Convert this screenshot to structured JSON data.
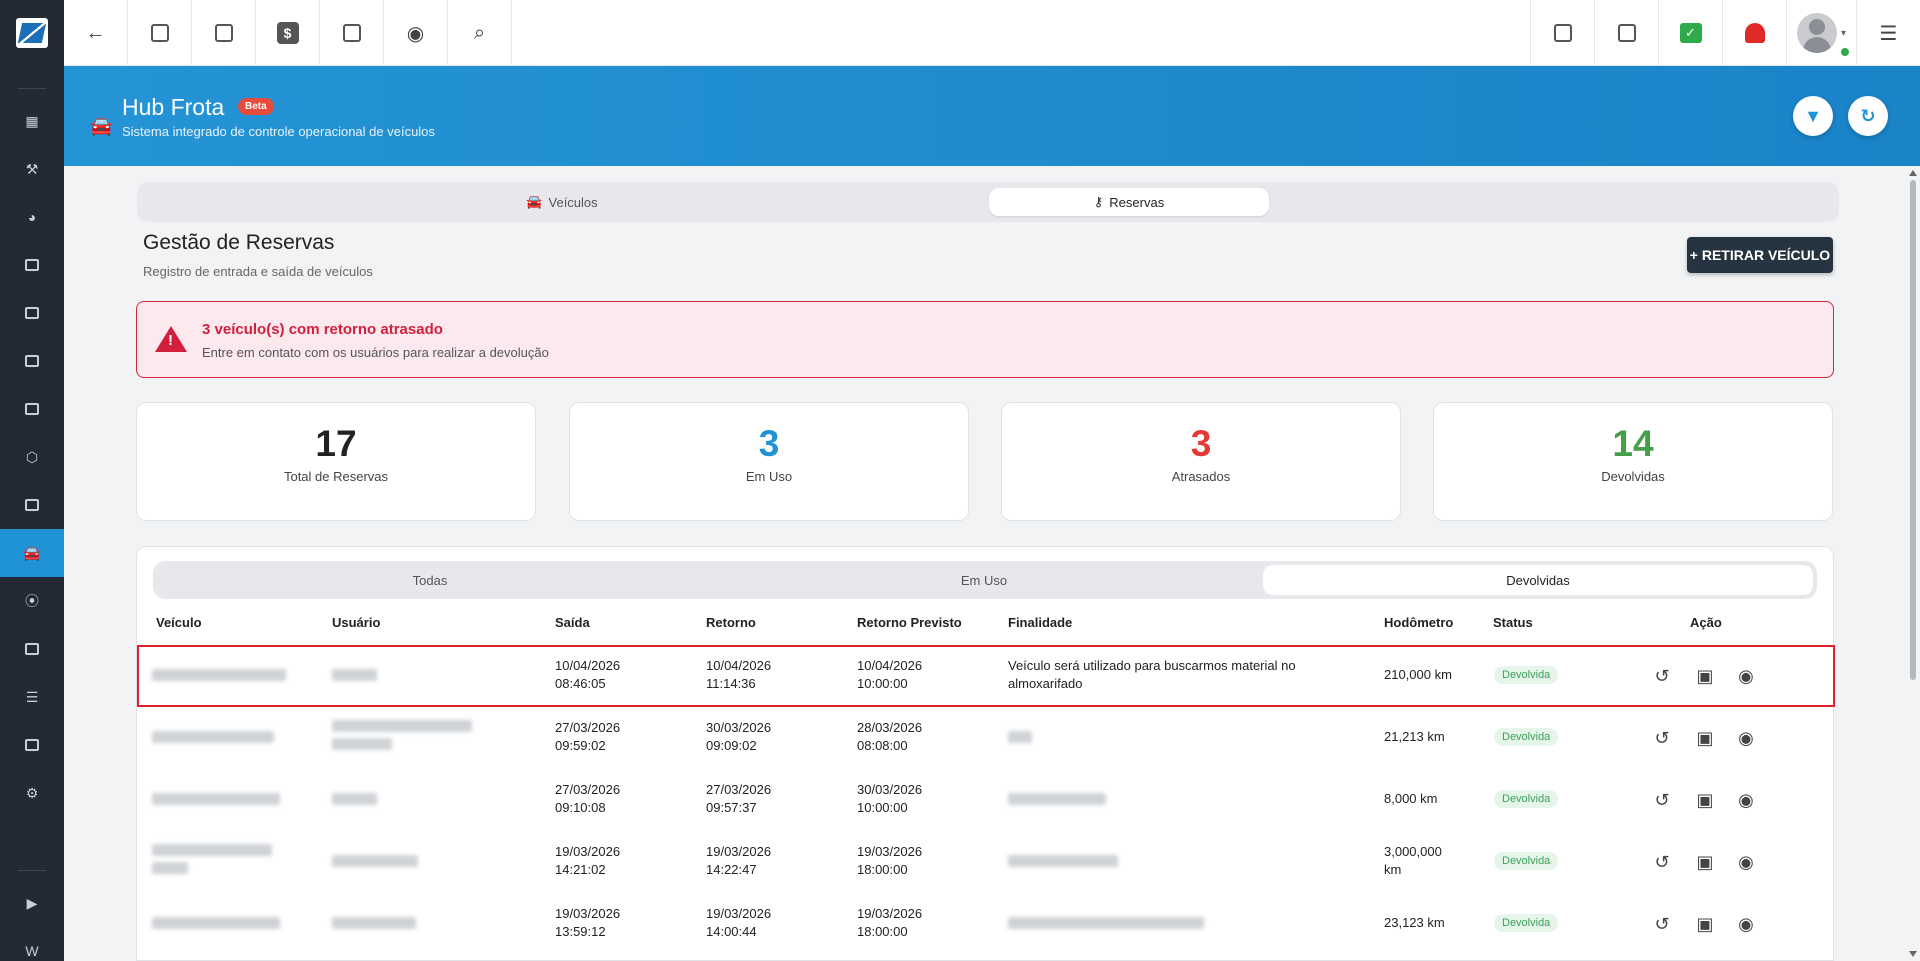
{
  "app": {
    "name": "Hub Frota",
    "badge": "Beta",
    "subtitle": "Sistema integrado de controle operacional de veículos"
  },
  "topbar": {
    "left_icons": [
      "back-arrow-icon",
      "contact-card-icon",
      "calendar-clock-icon",
      "dollar-icon",
      "terminal-icon",
      "eye-icon",
      "search-icon"
    ],
    "right_icons": [
      "pdf-file-icon",
      "building-icon",
      "green-check-icon",
      "red-bell-icon",
      "user-avatar",
      "list-icon"
    ]
  },
  "sidebar": {
    "icons": [
      "dashboard-icon",
      "tools-icon",
      "pie-chart-icon",
      "contact-icon",
      "kanban-icon",
      "calendar-icon",
      "building-icon",
      "box-icon",
      "money-icon",
      "car-icon",
      "map-pin-icon",
      "document-icon",
      "server-icon",
      "file-icon",
      "settings-icon",
      "video-icon",
      "w-icon"
    ],
    "active": "car-icon"
  },
  "tabs": {
    "vehicles": "Veículos",
    "reservations": "Reservas"
  },
  "page": {
    "title": "Gestão de Reservas",
    "subtitle": "Registro de entrada e saída de veículos",
    "action": "+ RETIRAR VEÍCULO"
  },
  "alert": {
    "title": "3 veículo(s) com retorno atrasado",
    "text": "Entre em contato com os usuários para realizar a devolução"
  },
  "stats": [
    {
      "value": "17",
      "label": "Total de Reservas",
      "color": "#222222"
    },
    {
      "value": "3",
      "label": "Em Uso",
      "color": "#1f93d6"
    },
    {
      "value": "3",
      "label": "Atrasados",
      "color": "#e53935"
    },
    {
      "value": "14",
      "label": "Devolvidas",
      "color": "#43a047"
    }
  ],
  "filter_tabs": {
    "all": "Todas",
    "in_use": "Em Uso",
    "returned": "Devolvidas",
    "active": "Devolvidas"
  },
  "table": {
    "headers": {
      "vehicle": "Veículo",
      "user": "Usuário",
      "departure": "Saída",
      "return": "Retorno",
      "expected": "Retorno Previsto",
      "purpose": "Finalidade",
      "odometer": "Hodômetro",
      "status": "Status",
      "action": "Ação"
    },
    "rows": [
      {
        "dep_date": "10/04/2026",
        "dep_time": "08:46:05",
        "ret_date": "10/04/2026",
        "ret_time": "11:14:36",
        "exp_date": "10/04/2026",
        "exp_time": "10:00:00",
        "purpose_l1": "Veículo será utilizado para buscarmos material no",
        "purpose_l2": "almoxarifado",
        "odo_l1": "210,000 km",
        "odo_l2": "",
        "status": "Devolvida"
      },
      {
        "dep_date": "27/03/2026",
        "dep_time": "09:59:02",
        "ret_date": "30/03/2026",
        "ret_time": "09:09:02",
        "exp_date": "28/03/2026",
        "exp_time": "08:08:00",
        "purpose_l1": "",
        "purpose_l2": "",
        "odo_l1": "21,213 km",
        "odo_l2": "",
        "status": "Devolvida"
      },
      {
        "dep_date": "27/03/2026",
        "dep_time": "09:10:08",
        "ret_date": "27/03/2026",
        "ret_time": "09:57:37",
        "exp_date": "30/03/2026",
        "exp_time": "10:00:00",
        "purpose_l1": "",
        "purpose_l2": "",
        "odo_l1": "8,000 km",
        "odo_l2": "",
        "status": "Devolvida"
      },
      {
        "dep_date": "19/03/2026",
        "dep_time": "14:21:02",
        "ret_date": "19/03/2026",
        "ret_time": "14:22:47",
        "exp_date": "19/03/2026",
        "exp_time": "18:00:00",
        "purpose_l1": "",
        "purpose_l2": "",
        "odo_l1": "3,000,000",
        "odo_l2": "km",
        "status": "Devolvida"
      },
      {
        "dep_date": "19/03/2026",
        "dep_time": "13:59:12",
        "ret_date": "19/03/2026",
        "ret_time": "14:00:44",
        "exp_date": "19/03/2026",
        "exp_time": "18:00:00",
        "purpose_l1": "",
        "purpose_l2": "",
        "odo_l1": "23,123 km",
        "odo_l2": "",
        "status": "Devolvida"
      }
    ]
  }
}
